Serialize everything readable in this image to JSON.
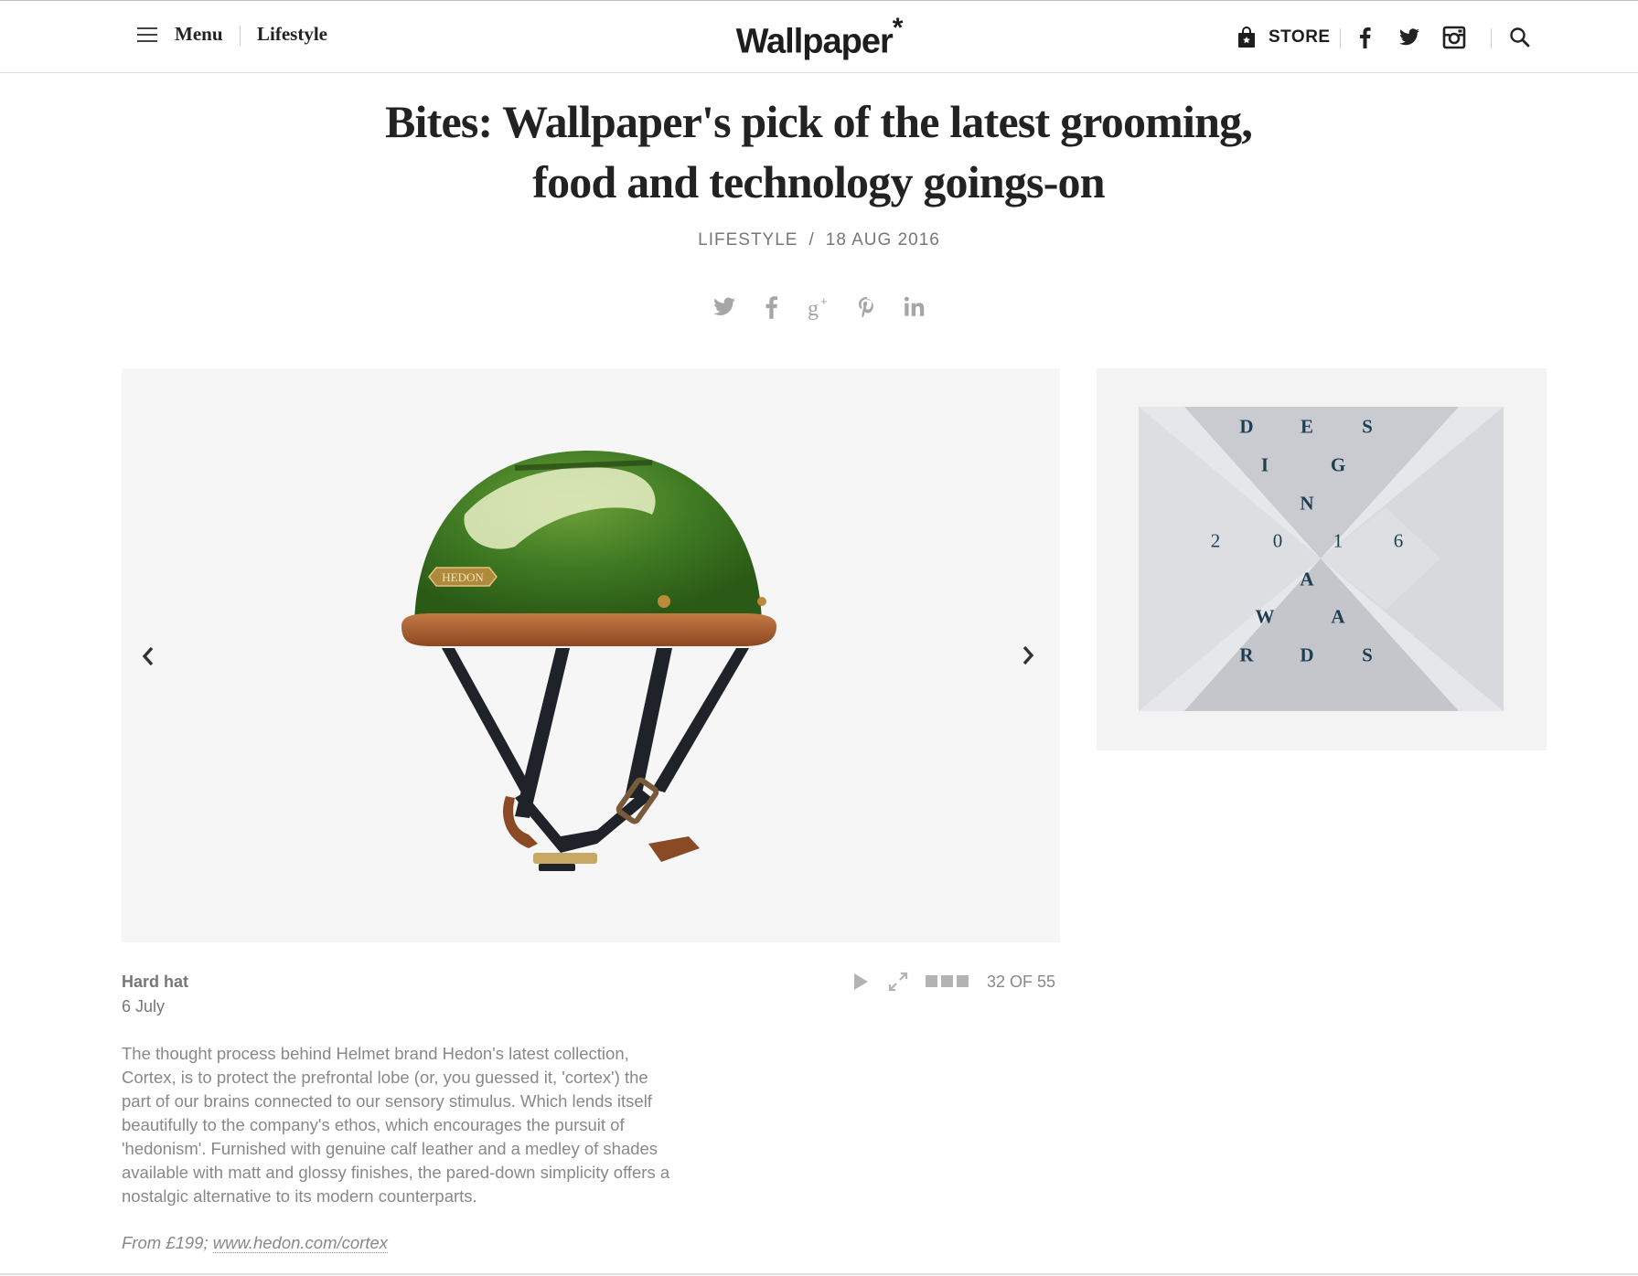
{
  "header": {
    "menu_label": "Menu",
    "section_label": "Lifestyle",
    "logo_text": "Wallpaper",
    "logo_mark": "*",
    "store_label": "STORE",
    "icons": [
      "bag-icon",
      "facebook-icon",
      "twitter-icon",
      "instagram-icon",
      "search-icon"
    ]
  },
  "article": {
    "title_line1": "Bites: Wallpaper's pick of the latest grooming,",
    "title_line2": "food and technology goings-on",
    "category": "LIFESTYLE",
    "separator": "/",
    "date": "18 AUG 2016",
    "share_icons": [
      "twitter-icon",
      "facebook-icon",
      "google-plus-icon",
      "pinterest-icon",
      "linkedin-icon"
    ]
  },
  "gallery": {
    "image_subject": "green-helmet-image",
    "caption_title": "Hard hat",
    "caption_date": "6 July",
    "counter": "32 OF 55",
    "current": 32,
    "total": 55,
    "controls": [
      "play-icon",
      "expand-icon",
      "grid-icon"
    ],
    "body": "The thought process behind Helmet brand Hedon's latest collection, Cortex, is to protect the prefrontal lobe (or, you guessed it, 'cortex') the part of our brains connected to our sensory stimulus. Which lends itself beautifully to the company's ethos, which encourages the pursuit of 'hedonism'. Furnished with genuine calf leather and a medley of shades available with matt and glossy finishes, the pared-down simplicity offers a nostalgic alternative to its modern counterparts.",
    "price_prefix": "From £199; ",
    "price_link": "www.hedon.com/cortex",
    "helmet_logo": "HEDON"
  },
  "ad": {
    "letters": [
      "D",
      "E",
      "S",
      "I",
      "G",
      "N",
      "2",
      "0",
      "1",
      "6",
      "A",
      "W",
      "A",
      "R",
      "D",
      "S"
    ],
    "text_color": "#1f3e52"
  },
  "colors": {
    "helmet_green": "#3f7a23",
    "leather_brown": "#a9582b",
    "strap": "#1f2228",
    "ad_background": "#f3f3f3"
  }
}
